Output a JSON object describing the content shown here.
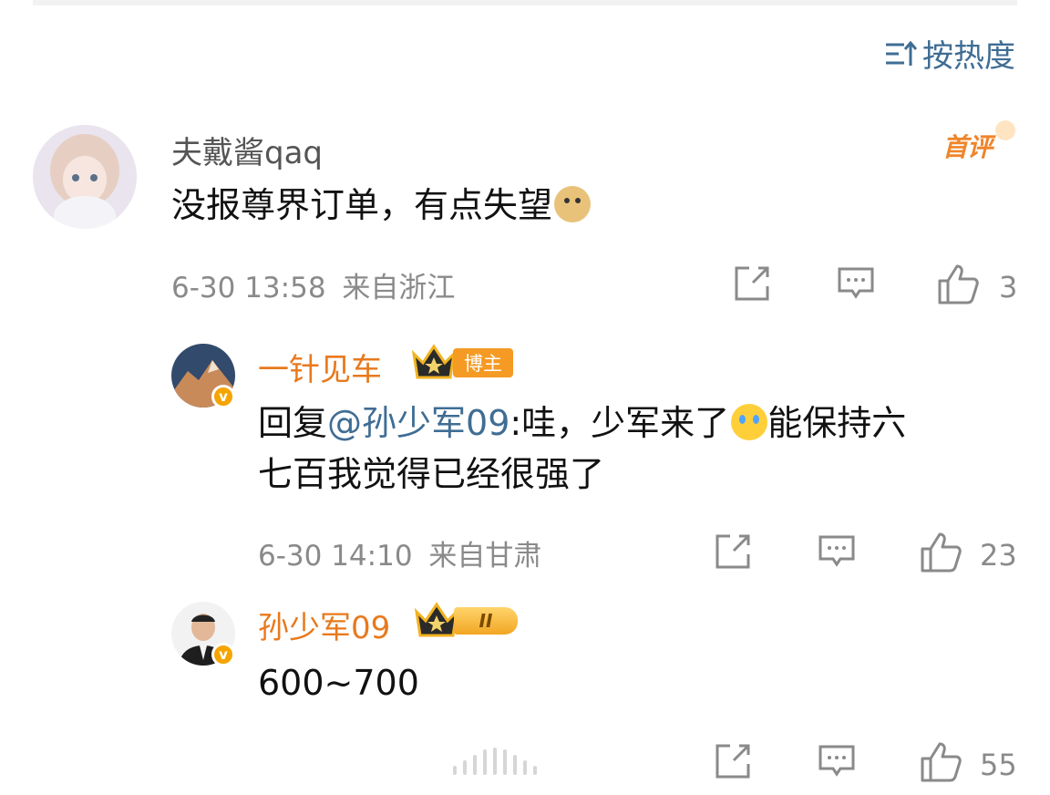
{
  "sort": {
    "label": "按热度",
    "icon": "sort-icon"
  },
  "comment": {
    "user": "夫戴酱qaq",
    "first_badge": "首评",
    "text": "没报尊界订单，有点失望",
    "emoji": "doge-emoji",
    "time": "6-30 13:58",
    "location": "来自浙江",
    "likes": "3"
  },
  "replies": [
    {
      "user": "一针见车",
      "tag": "博主",
      "prefix": "回复",
      "mention": "@孙少军09",
      "text_a": ":哇，少军来了",
      "emoji": "cry-emoji",
      "text_b": "能保持六",
      "text_line2": "七百我觉得已经很强了",
      "time": "6-30 14:10",
      "location": "来自甘肃",
      "likes": "23"
    },
    {
      "user": "孙少军09",
      "level": "II",
      "text": "600~700",
      "likes": "55"
    }
  ],
  "colors": {
    "link": "#3f6d94",
    "orange": "#e8791d",
    "gray": "#8a8a8a"
  }
}
